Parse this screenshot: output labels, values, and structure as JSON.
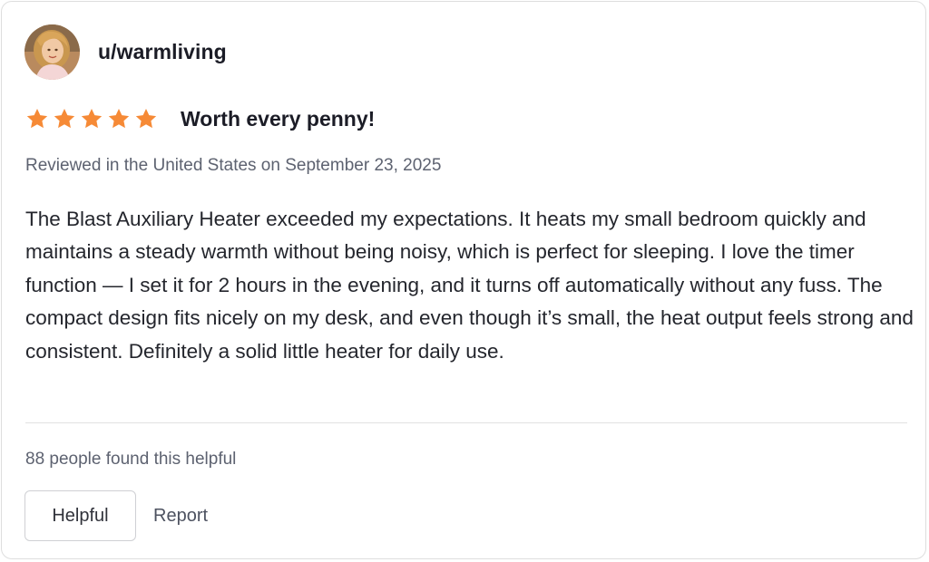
{
  "review": {
    "username": "u/warmliving",
    "avatar_icon": "user-avatar-photo",
    "rating": 5,
    "rating_max": 5,
    "star_color": "#f68a36",
    "title": "Worth every penny!",
    "reviewed_line": "Reviewed in the United States on September 23, 2025",
    "body": "The Blast Auxiliary Heater exceeded my expectations. It heats my small bedroom quickly and maintains a steady warmth without being noisy, which is perfect for sleeping. I love the timer function — I set it for 2 hours in the evening, and it turns off automatically without any fuss. The compact design fits nicely on my desk, and even though it’s small, the heat output feels strong and consistent. Definitely a solid little heater for daily use.",
    "helpful_count_text": "88 people found this helpful"
  },
  "actions": {
    "helpful_label": "Helpful",
    "report_label": "Report"
  }
}
